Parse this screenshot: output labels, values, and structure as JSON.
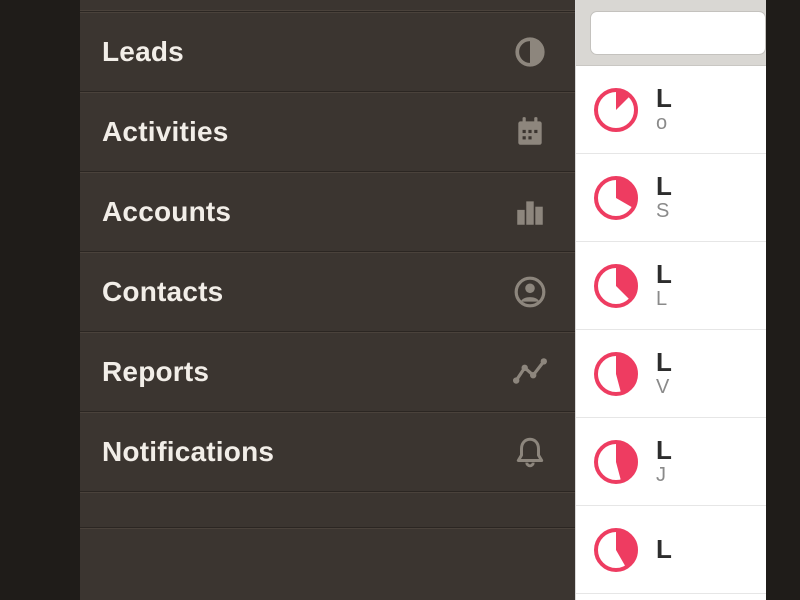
{
  "sidebar": {
    "items": [
      {
        "label": "Leads",
        "icon": "half-circle-icon"
      },
      {
        "label": "Activities",
        "icon": "calendar-icon"
      },
      {
        "label": "Accounts",
        "icon": "bars-icon"
      },
      {
        "label": "Contacts",
        "icon": "person-circle-icon"
      },
      {
        "label": "Reports",
        "icon": "line-chart-icon"
      },
      {
        "label": "Notifications",
        "icon": "bell-icon"
      }
    ]
  },
  "search": {
    "placeholder": ""
  },
  "list": {
    "rows": [
      {
        "title": "L",
        "sub": "o",
        "fill_deg": 45
      },
      {
        "title": "L",
        "sub": "S",
        "fill_deg": 120
      },
      {
        "title": "L",
        "sub": "L",
        "fill_deg": 135
      },
      {
        "title": "L",
        "sub": "V",
        "fill_deg": 165
      },
      {
        "title": "L",
        "sub": "J",
        "fill_deg": 165
      },
      {
        "title": "L",
        "sub": "",
        "fill_deg": 150
      }
    ],
    "accent": "#ee3c61"
  }
}
